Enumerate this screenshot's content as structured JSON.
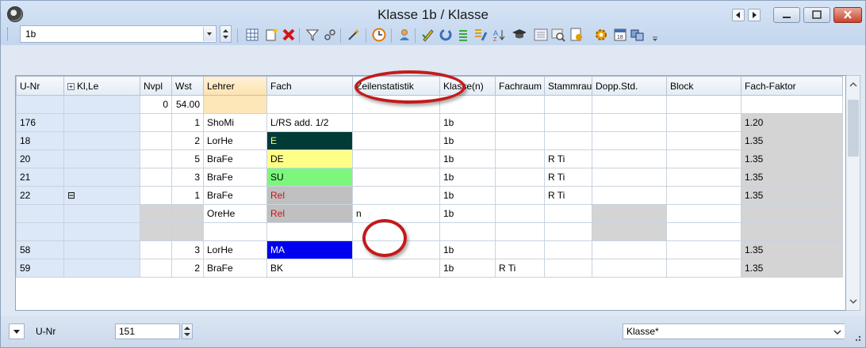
{
  "window": {
    "title": "Klasse 1b / Klasse"
  },
  "toolbar": {
    "combo_value": "1b"
  },
  "grid": {
    "headers": [
      "U-Nr",
      "Kl,Le",
      "Nvpl",
      "Wst",
      "Lehrer",
      "Fach",
      "Zeilenstatistik",
      "Klasse(n)",
      "Fachraum",
      "Stammraum",
      "Dopp.Std.",
      "Block",
      "Fach-Faktor"
    ],
    "sum_row": {
      "nvpl": "0",
      "wst": "54.00"
    },
    "rows": [
      {
        "unr": "176",
        "kl": "",
        "nvpl": "",
        "wst": "1",
        "lehrer": "ShoMi",
        "fach": "L/RS add. 1/2",
        "zeile": "",
        "klasse": "1b",
        "fachraum": "",
        "stammraum": "",
        "dopp": "",
        "block": "",
        "faktor": "1.20"
      },
      {
        "unr": "18",
        "kl": "",
        "nvpl": "",
        "wst": "2",
        "lehrer": "LorHe",
        "fach": "E",
        "zeile": "",
        "klasse": "1b",
        "fachraum": "",
        "stammraum": "",
        "dopp": "",
        "block": "",
        "faktor": "1.35"
      },
      {
        "unr": "20",
        "kl": "",
        "nvpl": "",
        "wst": "5",
        "lehrer": "BraFe",
        "fach": "DE",
        "zeile": "",
        "klasse": "1b",
        "fachraum": "",
        "stammraum": "R Ti",
        "dopp": "",
        "block": "",
        "faktor": "1.35"
      },
      {
        "unr": "21",
        "kl": "",
        "nvpl": "",
        "wst": "3",
        "lehrer": "BraFe",
        "fach": "SU",
        "zeile": "",
        "klasse": "1b",
        "fachraum": "",
        "stammraum": "R Ti",
        "dopp": "",
        "block": "",
        "faktor": "1.35"
      },
      {
        "unr": "22",
        "kl": "⊟",
        "nvpl": "",
        "wst": "1",
        "lehrer": "BraFe",
        "fach": "Rel",
        "zeile": "",
        "klasse": "1b",
        "fachraum": "",
        "stammraum": "R Ti",
        "dopp": "",
        "block": "",
        "faktor": "1.35"
      },
      {
        "unr": "",
        "kl": "",
        "nvpl": "",
        "wst": "",
        "lehrer": "OreHe",
        "fach": "Rel",
        "zeile": "n",
        "klasse": "1b",
        "fachraum": "",
        "stammraum": "",
        "dopp": "",
        "block": "",
        "faktor": ""
      },
      {
        "unr": "",
        "kl": "",
        "nvpl": "",
        "wst": "",
        "lehrer": "",
        "fach": "",
        "zeile": "",
        "klasse": "",
        "fachraum": "",
        "stammraum": "",
        "dopp": "",
        "block": "",
        "faktor": ""
      },
      {
        "unr": "58",
        "kl": "",
        "nvpl": "",
        "wst": "3",
        "lehrer": "LorHe",
        "fach": "MA",
        "zeile": "",
        "klasse": "1b",
        "fachraum": "",
        "stammraum": "",
        "dopp": "",
        "block": "",
        "faktor": "1.35"
      },
      {
        "unr": "59",
        "kl": "",
        "nvpl": "",
        "wst": "2",
        "lehrer": "BraFe",
        "fach": "BK",
        "zeile": "",
        "klasse": "1b",
        "fachraum": "R Ti",
        "stammraum": "",
        "dopp": "",
        "block": "",
        "faktor": "1.35"
      }
    ],
    "fach_colors": {
      "E": {
        "bg": "#003b38",
        "fg": "#ffff66"
      },
      "DE": {
        "bg": "#ffff88",
        "fg": "#000000"
      },
      "SU": {
        "bg": "#7cf77c",
        "fg": "#000000"
      },
      "Rel": {
        "bg": "#c0c0c0",
        "fg": "#d01010"
      },
      "MA": {
        "bg": "#0000ee",
        "fg": "#ffffff"
      }
    }
  },
  "bottom": {
    "field_label": "U-Nr",
    "field_value": "151",
    "view_value": "Klasse*"
  }
}
